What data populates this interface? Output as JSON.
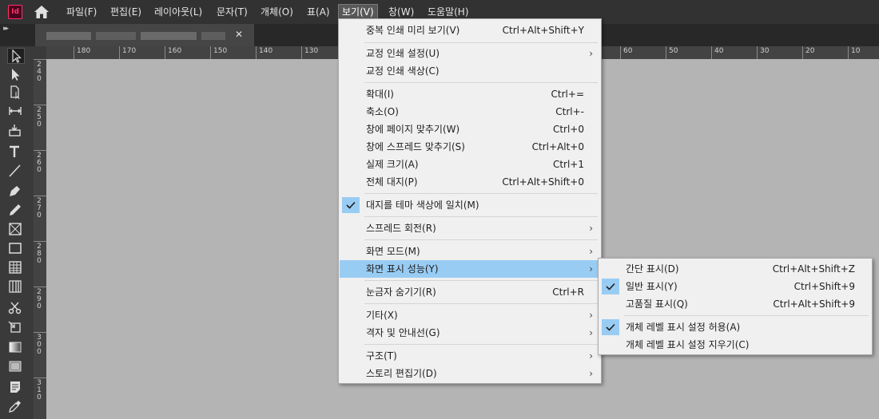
{
  "menubar": {
    "logo": "Id",
    "items": [
      "파일(F)",
      "편집(E)",
      "레이아웃(L)",
      "문자(T)",
      "개체(O)",
      "표(A)",
      "보기(V)",
      "창(W)",
      "도움말(H)"
    ]
  },
  "tab": {
    "close": "✕"
  },
  "ruler": {
    "h_labels": [
      "180",
      "170",
      "160",
      "150",
      "140",
      "130",
      "60",
      "50",
      "40",
      "30",
      "20",
      "10"
    ],
    "v_labels": [
      "240",
      "250",
      "260",
      "270",
      "280",
      "290",
      "300",
      "310"
    ]
  },
  "view_menu": {
    "items": [
      {
        "label": "중복 인쇄 미리 보기(V)",
        "shortcut": "Ctrl+Alt+Shift+Y"
      },
      {
        "label": "교정 인쇄 설정(U)",
        "arrow": "›"
      },
      {
        "label": "교정 인쇄 색상(C)"
      },
      {
        "label": "확대(I)",
        "shortcut": "Ctrl+="
      },
      {
        "label": "축소(O)",
        "shortcut": "Ctrl+-"
      },
      {
        "label": "창에 페이지 맞추기(W)",
        "shortcut": "Ctrl+0"
      },
      {
        "label": "창에 스프레드 맞추기(S)",
        "shortcut": "Ctrl+Alt+0"
      },
      {
        "label": "실제 크기(A)",
        "shortcut": "Ctrl+1"
      },
      {
        "label": "전체 대지(P)",
        "shortcut": "Ctrl+Alt+Shift+0"
      },
      {
        "label": "대지를 테마 색상에 일치(M)",
        "checked": "✓"
      },
      {
        "label": "스프레드 회전(R)",
        "arrow": "›"
      },
      {
        "label": "화면 모드(M)",
        "arrow": "›"
      },
      {
        "label": "화면 표시 성능(Y)",
        "arrow": "›"
      },
      {
        "label": "눈금자 숨기기(R)",
        "shortcut": "Ctrl+R"
      },
      {
        "label": "기타(X)",
        "arrow": "›"
      },
      {
        "label": "격자 및 안내선(G)",
        "arrow": "›"
      },
      {
        "label": "구조(T)",
        "arrow": "›"
      },
      {
        "label": "스토리 편집기(D)",
        "arrow": "›"
      }
    ]
  },
  "display_performance_menu": {
    "items": [
      {
        "label": "간단 표시(D)",
        "shortcut": "Ctrl+Alt+Shift+Z"
      },
      {
        "label": "일반 표시(Y)",
        "shortcut": "Ctrl+Shift+9",
        "checked": "✓"
      },
      {
        "label": "고품질 표시(Q)",
        "shortcut": "Ctrl+Alt+Shift+9"
      },
      {
        "label": "개체 레벨 표시 설정 허용(A)",
        "checked": "✓"
      },
      {
        "label": "개체 레벨 표시 설정 지우기(C)"
      }
    ]
  },
  "colors": {
    "menubar": "#323232",
    "highlight": "#99ccf3",
    "pasteboard": "#b4b4b4",
    "logo": "#ff3366"
  }
}
